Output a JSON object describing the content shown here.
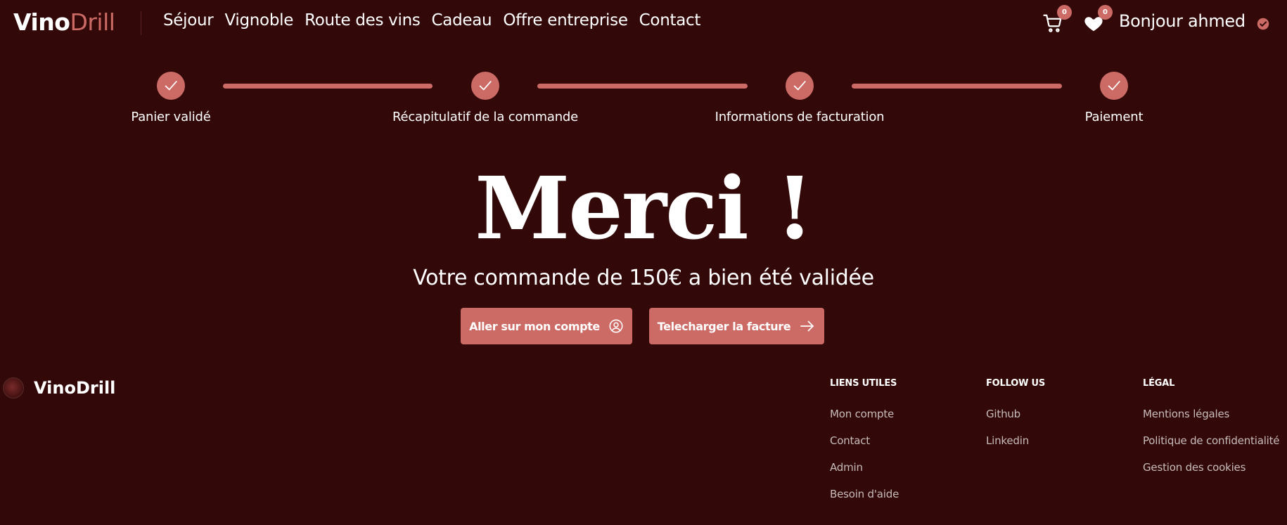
{
  "brand": {
    "vino": "Vino",
    "drill": "Drill"
  },
  "nav": {
    "links": [
      {
        "label": "Séjour"
      },
      {
        "label": "Vignoble"
      },
      {
        "label": "Route des vins"
      },
      {
        "label": "Cadeau"
      },
      {
        "label": "Offre entreprise"
      },
      {
        "label": "Contact"
      }
    ],
    "cart_count": "0",
    "wishlist_count": "0",
    "greeting": "Bonjour ahmed"
  },
  "steps": [
    {
      "label": "Panier validé",
      "status": "completed"
    },
    {
      "label": "Récapitulatif de la commande",
      "status": "completed"
    },
    {
      "label": "Informations de facturation",
      "status": "completed"
    },
    {
      "label": "Paiement",
      "status": "completed"
    }
  ],
  "main": {
    "title": "Merci !",
    "message": "Votre commande de 150€ a bien été validée",
    "account_button": "Aller sur mon compte",
    "invoice_button": "Telecharger la facture"
  },
  "footer": {
    "brand": "VinoDrill",
    "columns": [
      {
        "heading": "LIENS UTILES",
        "links": [
          "Mon compte",
          "Contact",
          "Admin",
          "Besoin d'aide"
        ]
      },
      {
        "heading": "FOLLOW US",
        "links": [
          "Github",
          "Linkedin"
        ]
      },
      {
        "heading": "LÉGAL",
        "links": [
          "Mentions légales",
          "Politique de confidentialité",
          "Gestion des cookies"
        ]
      }
    ]
  },
  "colors": {
    "background": "#320808",
    "accent": "#cc6b66",
    "text": "#ffffff",
    "muted_text": "#c8bcbc"
  },
  "icons": [
    "cart-icon",
    "heart-icon",
    "verified-check-icon",
    "check-icon",
    "user-circle-icon",
    "arrow-right-icon"
  ]
}
